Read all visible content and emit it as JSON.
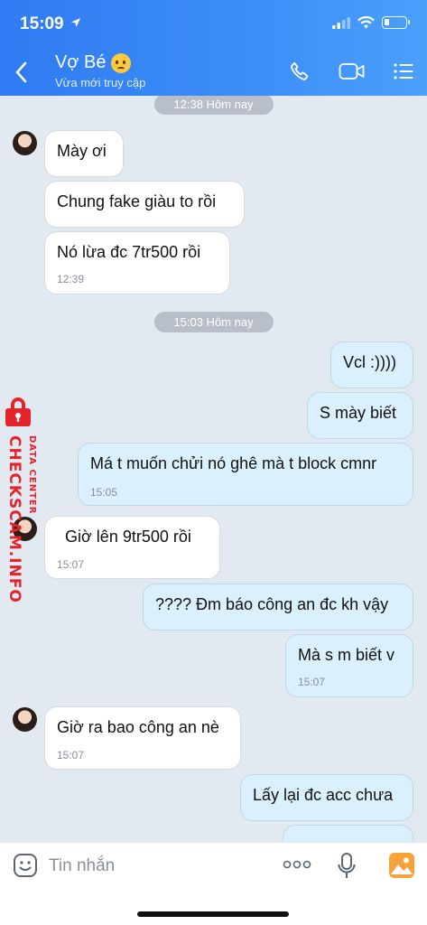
{
  "status_bar": {
    "time": "15:09"
  },
  "header": {
    "name": "Vợ Bé",
    "status": "Vừa mới truy cập"
  },
  "chat": {
    "time_pills": [
      "12:38 Hôm nay",
      "15:03 Hôm nay"
    ],
    "messages": [
      {
        "text": "Mày ơi",
        "time": ""
      },
      {
        "text": "Chung fake giàu to rồi",
        "time": ""
      },
      {
        "text": "Nó lừa đc 7tr500 rồi",
        "time": "12:39"
      },
      {
        "text": "Vcl :))))",
        "time": ""
      },
      {
        "text": "S mày biết",
        "time": ""
      },
      {
        "text": "Má t muốn chửi nó ghê mà t block cmnr",
        "time": "15:05"
      },
      {
        "text": "Giờ lên 9tr500 rồi",
        "time": "15:07"
      },
      {
        "text": "???? Đm báo công an đc kh vậy",
        "time": ""
      },
      {
        "text": "Mà s m biết v",
        "time": "15:07"
      },
      {
        "text": "Giờ ra bao công an nè",
        "time": "15:07"
      },
      {
        "text": "Lấy lại đc acc chưa",
        "time": ""
      }
    ]
  },
  "watermark": {
    "brand": "CHECKSCAM.INFO",
    "sub": "DATA CENTER"
  },
  "input": {
    "placeholder": "Tin nhắn"
  },
  "colors": {
    "header_blue": "#3d8ef7",
    "outgoing_bubble": "#daf0fd",
    "chat_bg": "#e2e9f1",
    "watermark_red": "#e4232b"
  }
}
